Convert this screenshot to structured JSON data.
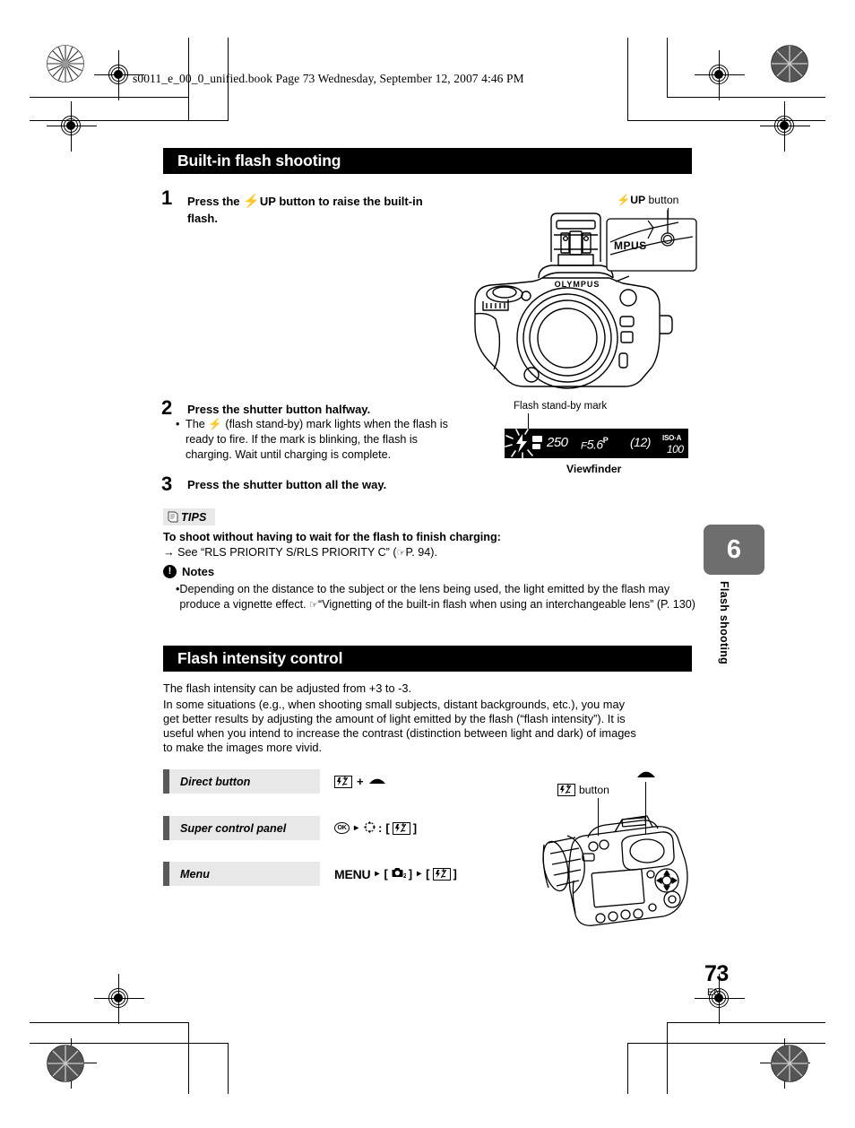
{
  "print_header": {
    "file_line": "s0011_e_00_0_unified.book  Page 73  Wednesday, September 12, 2007  4:46 PM"
  },
  "sections": [
    {
      "id": "built-in-flash",
      "title": "Built-in flash shooting"
    },
    {
      "id": "flash-intensity",
      "title": "Flash intensity control"
    }
  ],
  "steps": [
    {
      "number": "1",
      "text_prefix": "Press the",
      "icon": "flash-up-icon",
      "icon_label": "UP",
      "text_suffix": "button to raise the built-in flash.",
      "full_text": "Press the ⚡ UP button to raise the built-in flash."
    },
    {
      "number": "2",
      "full_text": "Press the shutter button halfway.",
      "bullets": [
        "The ⚡ (flash stand-by) mark lights when the flash is ready to fire. If the mark is blinking, the flash is charging. Wait until charging is complete."
      ]
    },
    {
      "number": "3",
      "full_text": "Press the shutter button all the way."
    }
  ],
  "tips": {
    "label": "TIPS",
    "heading": "To shoot without having to wait for the flash to finish charging:",
    "arrow": "→",
    "body": "See “RLS PRIORITY S/RLS PRIORITY C” (",
    "ref_page": "P. 94",
    "body_end": ")."
  },
  "notes": {
    "label": "Notes",
    "items": [
      "Depending on the distance to the subject or the lens being used, the light emitted by the flash may produce a vignette effect.",
      "“Vignetting of the built-in flash when using an interchangeable lens” (P. 130)"
    ]
  },
  "intensity_intro": [
    "The flash intensity can be adjusted from +3 to -3.",
    "In some situations (e.g., when shooting small subjects, distant backgrounds, etc.), you may",
    "get better results by adjusting the amount of light emitted by the flash (“flash intensity”). It is",
    "useful when you intend to increase the contrast (distinction between light and dark) of images",
    "to make the images more vivid."
  ],
  "methods": [
    {
      "name": "Direct button",
      "ops_text": "[flash-comp] + [dial]",
      "plus": "+"
    },
    {
      "name": "Super control panel",
      "ops_text": "[OK] ▸ [arrow-pad]: [[flash-comp]]",
      "ok_label": "OK",
      "colon": ":",
      "arrow": "▸",
      "bracket_open": "[",
      "bracket_close": "]"
    },
    {
      "name": "Menu",
      "menu_label": "MENU",
      "arrow": "▸",
      "cam_tab": "2",
      "bracket_open": "[",
      "bracket_close": "]"
    }
  ],
  "callouts": {
    "flash_up_button": {
      "icon": "flash-icon",
      "bold": "UP",
      "suffix": "button"
    },
    "flash_standby_mark": "Flash stand-by mark",
    "viewfinder": "Viewfinder",
    "flash_comp_button": "button",
    "dial": "dial-icon"
  },
  "viewfinder_display": {
    "shutter_speed": "250",
    "aperture_prefix": "F",
    "aperture": "5.6",
    "mode": "P",
    "buffer": "12",
    "iso_label": "ISO·A",
    "iso_value": "100"
  },
  "camera_illustrations": {
    "front": {
      "brand": "OLYMPUS",
      "zoom_brand": "MPUS"
    },
    "rear": {
      "name": "camera-rear-view"
    }
  },
  "side_tab": {
    "chapter": "6",
    "title": "Flash shooting",
    "color": "#6e6e6e"
  },
  "footer": {
    "page_number": "73",
    "language": "EN"
  }
}
